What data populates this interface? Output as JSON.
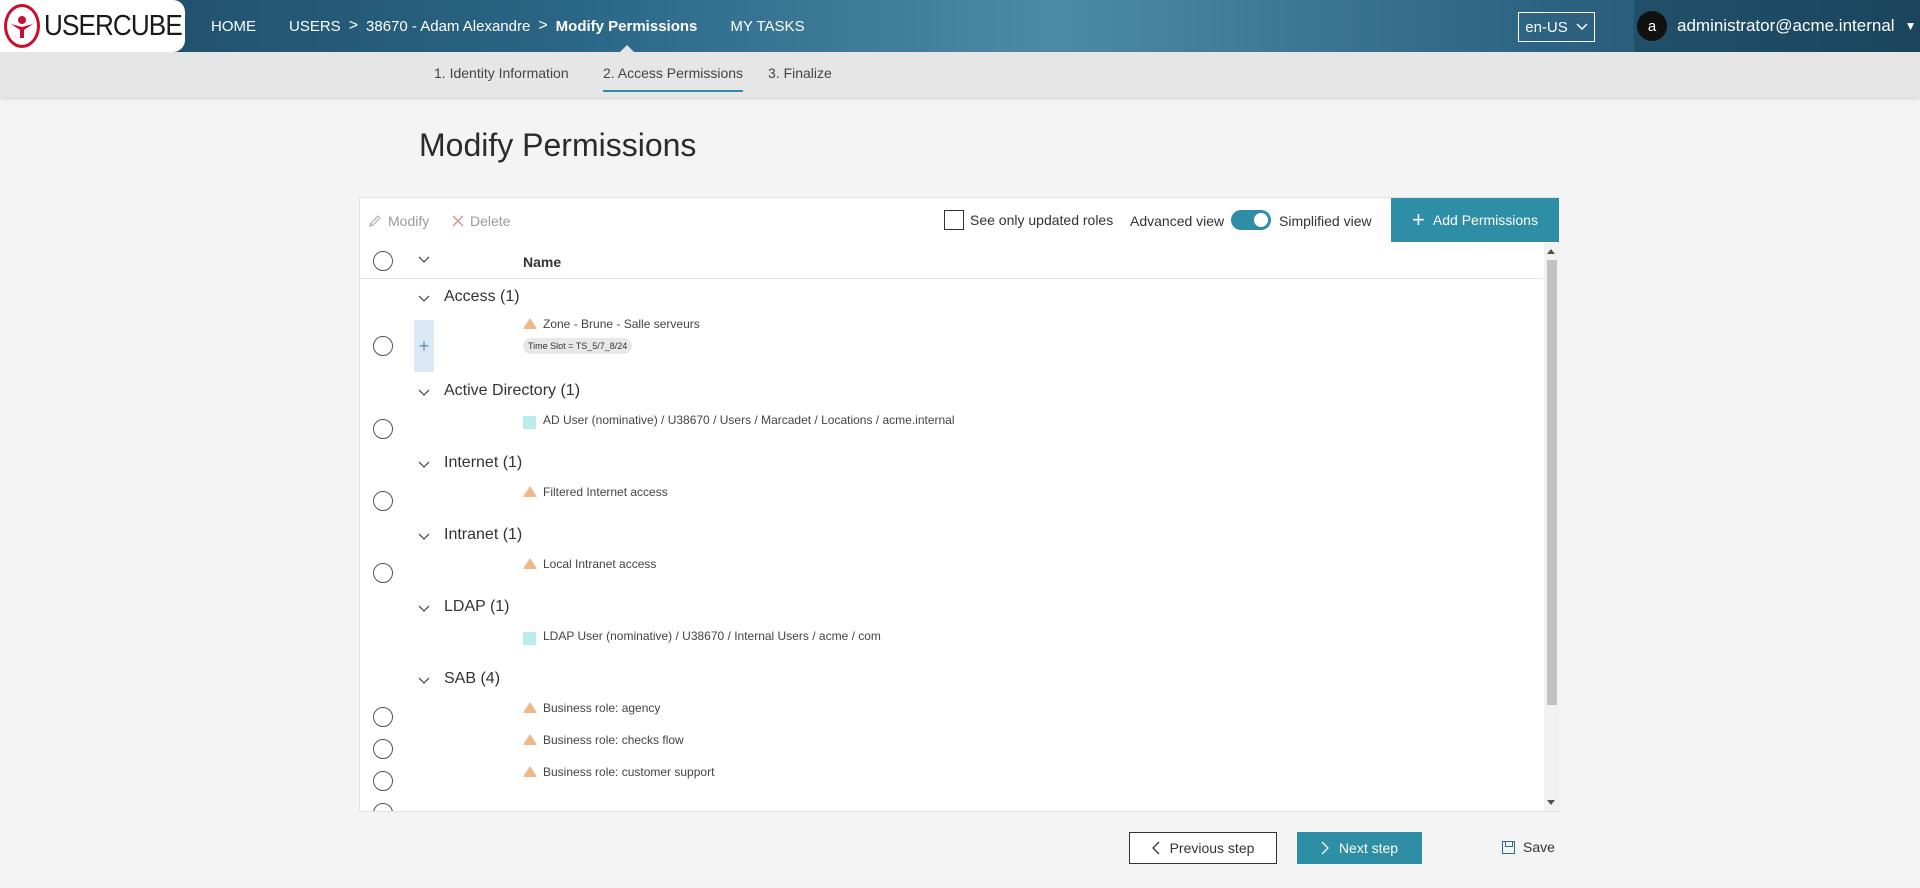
{
  "brand": {
    "name": "USERCUBE"
  },
  "breadcrumb": {
    "home": "HOME",
    "users": "USERS",
    "user": "38670 - Adam Alexandre",
    "current": "Modify Permissions",
    "my_tasks": "MY TASKS",
    "separator": ">"
  },
  "language": {
    "value": "en-US"
  },
  "user_menu": {
    "avatar_letter": "a",
    "email": "administrator@acme.internal"
  },
  "steps": [
    {
      "label": "1. Identity Information"
    },
    {
      "label": "2. Access Permissions"
    },
    {
      "label": "3. Finalize"
    }
  ],
  "page": {
    "title": "Modify Permissions"
  },
  "toolbar": {
    "modify_label": "Modify",
    "delete_label": "Delete",
    "updated_only_label": "See only updated roles",
    "advanced_view_label": "Advanced view",
    "simplified_view_label": "Simplified view",
    "add_label": "Add Permissions"
  },
  "table": {
    "name_header": "Name"
  },
  "groups": [
    {
      "title": "Access (1)",
      "items": [
        {
          "label": "Zone - Brune - Salle serveurs",
          "icon": "warning-triangle-icon",
          "tag": "Time Slot = TS_5/7_8/24"
        }
      ]
    },
    {
      "title": "Active Directory (1)",
      "items": [
        {
          "label": "AD User (nominative) / U38670 / Users / Marcadet / Locations / acme.internal",
          "icon": "resource-square-icon"
        }
      ]
    },
    {
      "title": "Internet (1)",
      "items": [
        {
          "label": "Filtered Internet access",
          "icon": "warning-triangle-icon"
        }
      ]
    },
    {
      "title": "Intranet (1)",
      "items": [
        {
          "label": "Local Intranet access",
          "icon": "warning-triangle-icon"
        }
      ]
    },
    {
      "title": "LDAP (1)",
      "items": [
        {
          "label": "LDAP User (nominative) / U38670 / Internal Users / acme / com",
          "icon": "resource-square-icon"
        }
      ]
    },
    {
      "title": "SAB (4)",
      "items": [
        {
          "label": "Business role: agency",
          "icon": "warning-triangle-icon"
        },
        {
          "label": "Business role: checks flow",
          "icon": "warning-triangle-icon"
        },
        {
          "label": "Business role: customer support",
          "icon": "warning-triangle-icon"
        }
      ]
    }
  ],
  "footer": {
    "previous_label": "Previous step",
    "next_label": "Next step",
    "save_label": "Save"
  },
  "colors": {
    "accent": "#2e8ea5",
    "warning_icon": "#f0b88a",
    "resource_icon": "#b9ecec"
  }
}
